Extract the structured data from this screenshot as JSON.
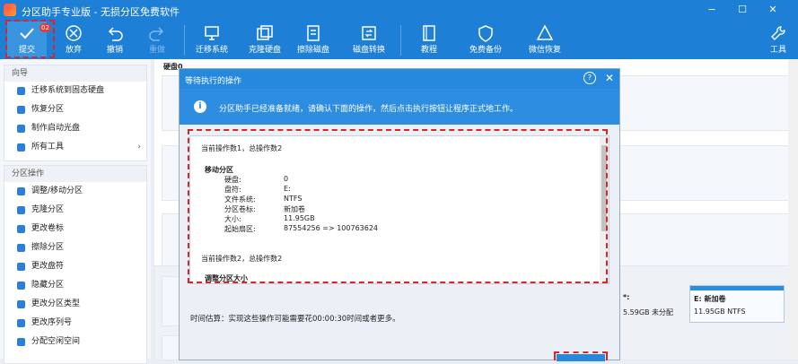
{
  "window": {
    "title": "分区助手专业版 - 无损分区免费软件"
  },
  "toolbar": {
    "commit_label": "提交",
    "commit_badge": "02",
    "discard_label": "放弃",
    "undo_label": "撤销",
    "redo_label": "重做",
    "migrate_os_label": "迁移系统",
    "clone_disk_label": "克隆硬盘",
    "wipe_disk_label": "擦除磁盘",
    "disk_convert_label": "磁盘转换",
    "tutorial_label": "教程",
    "free_backup_label": "免费备份",
    "wechat_restore_label": "微信恢复",
    "tools_label": "工具"
  },
  "sidebar": {
    "wizard_header": "向导",
    "wizard_items": [
      "迁移系统到固态硬盘",
      "恢复分区",
      "制作启动光盘",
      "所有工具"
    ],
    "partition_header": "分区操作",
    "partition_items": [
      "调整/移动分区",
      "克隆分区",
      "更改卷标",
      "擦除分区",
      "更改盘符",
      "隐藏分区",
      "更改分区类型",
      "更改序列号",
      "分配空闲空间"
    ]
  },
  "main": {
    "disk_header": "硬盘0",
    "right_partition": {
      "letter": "E: 新加卷",
      "size": "11.95GB NTFS"
    },
    "partial_partition": {
      "letter": "*:",
      "size": "5.59GB 未分配"
    }
  },
  "dialog": {
    "title": "等待执行的操作",
    "info": "分区助手已经准备就绪，请确认下面的操作，然后点击执行按钮让程序正式地工作。",
    "op1_header": "当前操作数1，总操作数2",
    "op1_title": "移动分区",
    "op1_rows": [
      {
        "k": "硬盘:",
        "v": "0"
      },
      {
        "k": "盘符:",
        "v": "E:"
      },
      {
        "k": "文件系统:",
        "v": "NTFS"
      },
      {
        "k": "分区卷标:",
        "v": "新加卷"
      },
      {
        "k": "大小:",
        "v": "11.95GB"
      },
      {
        "k": "起始扇区:",
        "v": "87554256 => 100763624"
      }
    ],
    "op2_header": "当前操作数2，总操作数2",
    "op2_title": "调整分区大小",
    "estimate": "时间估算：实现这些操作可能需要花00:00:30时间或者更多。"
  }
}
